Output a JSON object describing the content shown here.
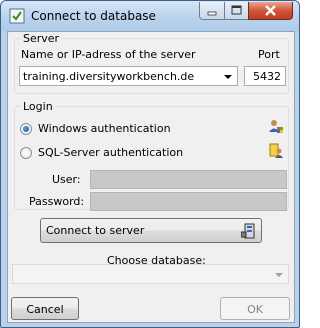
{
  "window": {
    "title": "Connect to database",
    "icon": "database-icon"
  },
  "titlebar_buttons": {
    "minimize": "minimize-icon",
    "maximize": "maximize-icon",
    "close": "close-icon"
  },
  "server": {
    "group_label": "Server",
    "name_label": "Name or IP-adress of the server",
    "name_value": "training.diversityworkbench.de",
    "port_label": "Port",
    "port_value": "5432"
  },
  "login": {
    "group_label": "Login",
    "windows_auth_label": "Windows authentication",
    "windows_auth_selected": true,
    "sql_auth_label": "SQL-Server authentication",
    "sql_auth_selected": false,
    "user_label": "User:",
    "password_label": "Password:",
    "user_value": "",
    "password_value": ""
  },
  "connect_button": {
    "label": "Connect to server",
    "icon": "connect-server-icon"
  },
  "database": {
    "label": "Choose database:",
    "value": ""
  },
  "footer": {
    "cancel_label": "Cancel",
    "ok_label": "OK"
  },
  "colors": {
    "selection_blue": "#0c4d97",
    "window_frame": "#b9d1ea"
  }
}
